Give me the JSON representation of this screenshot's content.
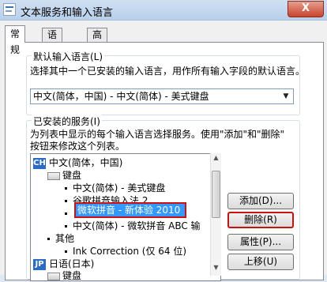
{
  "window": {
    "title": "文本服务和输入语言",
    "close_label": "X"
  },
  "tabs": [
    {
      "label": "常规"
    },
    {
      "label": "语言栏"
    },
    {
      "label": "高级键设置"
    }
  ],
  "default_language": {
    "group_label": "默认输入语言(L)",
    "description": "选择其中一个已安装的输入语言，用作所有输入字段的默认语言。",
    "selected_value": "中文(简体，中国) - 中文(简体) - 美式键盘"
  },
  "installed_services": {
    "group_label": "已安装的服务(I)",
    "description_line1": "为列表中显示的每个输入语言选择服务。使用\"添加\"和\"删除\"",
    "description_line2": "按钮来修改这个列表。",
    "tree": {
      "lang1_badge": "CH",
      "lang1_label": "中文(简体，中国)",
      "keyboard_label": "键盘",
      "item1": "中文(简体) - 美式键盘",
      "item2": "谷歌拼音输入法 2",
      "item3_selected": "微软拼音 - 新体验 2010",
      "item4": "中文(简体) - 微软拼音 ABC 输",
      "other_label": "其他",
      "other_item": "Ink Correction (仅 64 位)",
      "lang2_badge": "JP",
      "lang2_label": "日语(日本)",
      "lang2_keyboard": "键盘"
    },
    "buttons": {
      "add": "添加(D)...",
      "remove": "删除(R)",
      "properties": "属性(P)...",
      "move_up": "上移(U)"
    }
  }
}
